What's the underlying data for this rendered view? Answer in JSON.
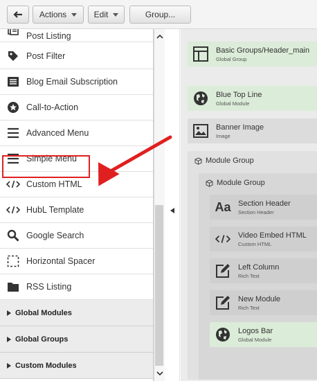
{
  "toolbar": {
    "back_icon": "back-arrow-icon",
    "actions_label": "Actions",
    "edit_label": "Edit",
    "group_label": "Group..."
  },
  "sidebar": {
    "items": [
      {
        "label": "Post Listing",
        "icon": "post-listing-icon"
      },
      {
        "label": "Post Filter",
        "icon": "tag-icon"
      },
      {
        "label": "Blog Email Subscription",
        "icon": "email-list-icon"
      },
      {
        "label": "Call-to-Action",
        "icon": "star-badge-icon"
      },
      {
        "label": "Advanced Menu",
        "icon": "menu-lines-icon"
      },
      {
        "label": "Simple Menu",
        "icon": "menu-lines-icon"
      },
      {
        "label": "Custom HTML",
        "icon": "code-icon"
      },
      {
        "label": "HubL Template",
        "icon": "code-icon"
      },
      {
        "label": "Google Search",
        "icon": "search-icon"
      },
      {
        "label": "Horizontal Spacer",
        "icon": "dashed-square-icon"
      },
      {
        "label": "RSS Listing",
        "icon": "folder-icon"
      }
    ],
    "groups": [
      {
        "label": "Global Modules"
      },
      {
        "label": "Global Groups"
      },
      {
        "label": "Custom Modules"
      }
    ]
  },
  "canvas": {
    "modules": [
      {
        "title": "Basic Groups/Header_main",
        "subtitle": "Global Group",
        "icon": "layout-icon",
        "color": "green"
      },
      {
        "title": "Blue Top Line",
        "subtitle": "Global Module",
        "icon": "globe-icon",
        "color": "green"
      },
      {
        "title": "Banner Image",
        "subtitle": "Image",
        "icon": "image-icon",
        "color": "grey"
      }
    ],
    "outer_group_label": "Module Group",
    "inner_group_label": "Module Group",
    "inner_modules": [
      {
        "title": "Section Header",
        "subtitle": "Section Header",
        "icon": "text-aa-icon",
        "color": "grey"
      },
      {
        "title": "Video Embed HTML",
        "subtitle": "Custom HTML",
        "icon": "code-icon",
        "color": "grey"
      },
      {
        "title": "Left Column",
        "subtitle": "Rich Text",
        "icon": "edit-icon",
        "color": "grey"
      },
      {
        "title": "New Module",
        "subtitle": "Rich Text",
        "icon": "edit-icon",
        "color": "grey"
      },
      {
        "title": "Logos Bar",
        "subtitle": "Global Module",
        "icon": "globe-icon",
        "color": "green"
      }
    ]
  },
  "annotation": {
    "highlight_color": "#e02020",
    "arrow_color": "#e02020"
  }
}
